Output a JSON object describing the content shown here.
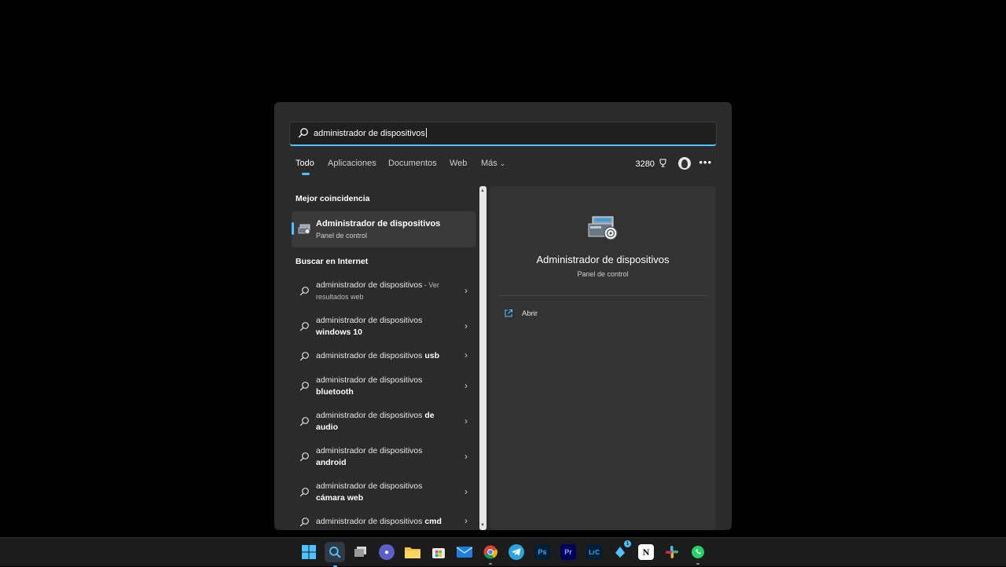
{
  "search": {
    "query": "administrador de dispositivos"
  },
  "tabs": [
    {
      "label": "Todo"
    },
    {
      "label": "Aplicaciones"
    },
    {
      "label": "Documentos"
    },
    {
      "label": "Web"
    },
    {
      "label": "Más"
    }
  ],
  "points": "3280",
  "left": {
    "best_match_heading": "Mejor coincidencia",
    "best_match": {
      "title": "Administrador de dispositivos",
      "subtitle": "Panel de control",
      "icon": "device-manager-icon"
    },
    "web_heading": "Buscar en Internet",
    "results": [
      {
        "base": "administrador de dispositivos",
        "bold": "",
        "suffix": " - Ver resultados web"
      },
      {
        "base": "administrador de dispositivos ",
        "bold": "windows 10",
        "suffix": ""
      },
      {
        "base": "administrador de dispositivos ",
        "bold": "usb",
        "suffix": ""
      },
      {
        "base": "administrador de dispositivos ",
        "bold": "bluetooth",
        "suffix": ""
      },
      {
        "base": "administrador de dispositivos ",
        "bold": "de audio",
        "suffix": ""
      },
      {
        "base": "administrador de dispositivos ",
        "bold": "android",
        "suffix": ""
      },
      {
        "base": "administrador de dispositivos ",
        "bold": "cámara web",
        "suffix": ""
      },
      {
        "base": "administrador de dispositivos ",
        "bold": "cmd",
        "suffix": ""
      }
    ]
  },
  "right": {
    "title": "Administrador de dispositivos",
    "subtitle": "Panel de control",
    "action_open": "Abrir"
  },
  "taskbar": {
    "apps": [
      {
        "name": "start",
        "label": ""
      },
      {
        "name": "search",
        "label": ""
      },
      {
        "name": "task-view",
        "label": ""
      },
      {
        "name": "chat",
        "label": ""
      },
      {
        "name": "file-explorer",
        "label": ""
      },
      {
        "name": "microsoft-store",
        "label": ""
      },
      {
        "name": "mail",
        "label": ""
      },
      {
        "name": "chrome",
        "label": ""
      },
      {
        "name": "telegram",
        "label": ""
      },
      {
        "name": "photoshop",
        "label": "Ps"
      },
      {
        "name": "premiere",
        "label": "Pr"
      },
      {
        "name": "lightroom-classic",
        "label": "LrC"
      },
      {
        "name": "steam",
        "label": "",
        "badge": "1"
      },
      {
        "name": "notion",
        "label": "N"
      },
      {
        "name": "slack",
        "label": ""
      },
      {
        "name": "whatsapp",
        "label": ""
      }
    ]
  },
  "colors": {
    "accent": "#4cc2ff",
    "panel": "#2b2b2b",
    "preview": "#333333"
  }
}
